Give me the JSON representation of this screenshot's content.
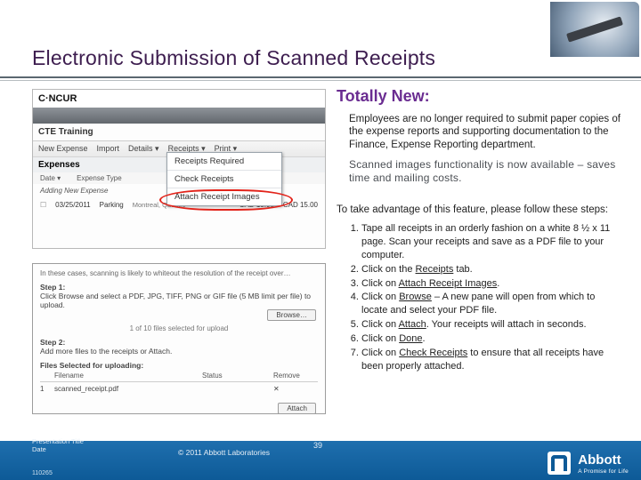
{
  "title": "Electronic Submission of Scanned Receipts",
  "right": {
    "heading": "Totally New:",
    "para1": "Employees are no longer required to submit paper copies of the expense reports and supporting documentation to the Finance, Expense Reporting department.",
    "para2": "Scanned images functionality is now available – saves time and mailing costs.",
    "follow": "To take advantage of this feature, please follow these steps:",
    "steps": [
      "Tape all receipts in an orderly fashion on a white 8 ½ x 11 page. Scan your receipts and save as a PDF file to your computer.",
      "Click on the Receipts tab.",
      "Click on Attach Receipt Images.",
      "Click on Browse – A new pane will open from which to locate and select your PDF file.",
      "Click on Attach. Your receipts will attach in seconds.",
      "Click on Done.",
      "Click on Check Receipts to ensure that all receipts have been properly attached."
    ]
  },
  "shot1": {
    "logo": "C·NCUR",
    "sub": "CTE Training",
    "toolbar": [
      "New Expense",
      "Import",
      "Details ▾",
      "Receipts ▾",
      "Print ▾"
    ],
    "expenses": "Expenses",
    "cols": [
      "Date ▾",
      "Expense Type"
    ],
    "adding": "Adding New Expense",
    "row": {
      "date": "03/25/2011",
      "type": "Parking",
      "city": "Montreal, Quebec",
      "amt": "CAD 15.00",
      "req": "CAD 15.00"
    },
    "menu": [
      "Receipts Required",
      "Check Receipts",
      "Attach Receipt Images"
    ]
  },
  "shot2": {
    "intro": "In these cases, scanning is likely to whiteout the resolution of the receipt over…",
    "step1_label": "Step 1:",
    "step1": "Click Browse and select a PDF, JPG, TIFF, PNG or GIF file (5 MB limit per file) to upload.",
    "browse": "Browse…",
    "selected": "1 of 10 files selected for upload",
    "step2_label": "Step 2:",
    "step2": "Add more files to the receipts or Attach.",
    "uploading_h": "Files Selected for uploading:",
    "cols": [
      "",
      "Filename",
      "Status",
      "Remove"
    ],
    "row": [
      "1",
      "scanned_receipt.pdf",
      "",
      "✕"
    ],
    "attach": "Attach"
  },
  "footer": {
    "ptitle": "Presentation Title",
    "pdate": "Date",
    "copy": "© 2011 Abbott Laboratories",
    "num": "39",
    "id": "110265",
    "brand": "Abbott",
    "tag": "A Promise for Life"
  }
}
